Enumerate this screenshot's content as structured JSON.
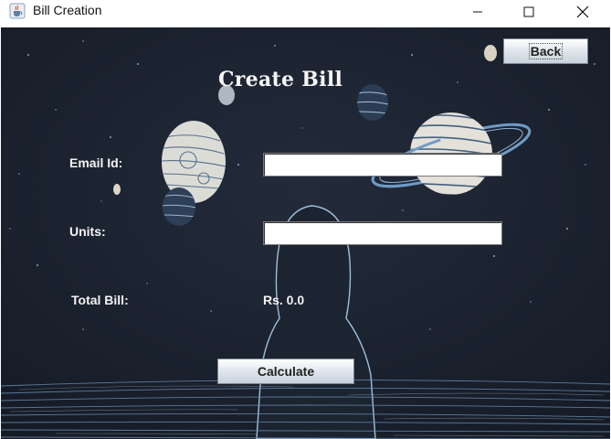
{
  "window": {
    "title": "Bill Creation",
    "icon": "java-coffee-cup-icon",
    "controls": [
      "minimize-icon",
      "maximize-icon",
      "close-icon"
    ]
  },
  "page": {
    "heading": "Create Bill",
    "back_label": "Back"
  },
  "form": {
    "email_label": "Email Id:",
    "email_value": "",
    "units_label": "Units:",
    "units_value": "",
    "total_label": "Total Bill:",
    "total_value": "Rs. 0.0",
    "calculate_label": "Calculate"
  },
  "background": {
    "description_colors": {
      "sky": "#1b2230",
      "planet": "#dfe3e6",
      "stripe": "#3d5878",
      "ring": "#7fa6cc"
    }
  }
}
